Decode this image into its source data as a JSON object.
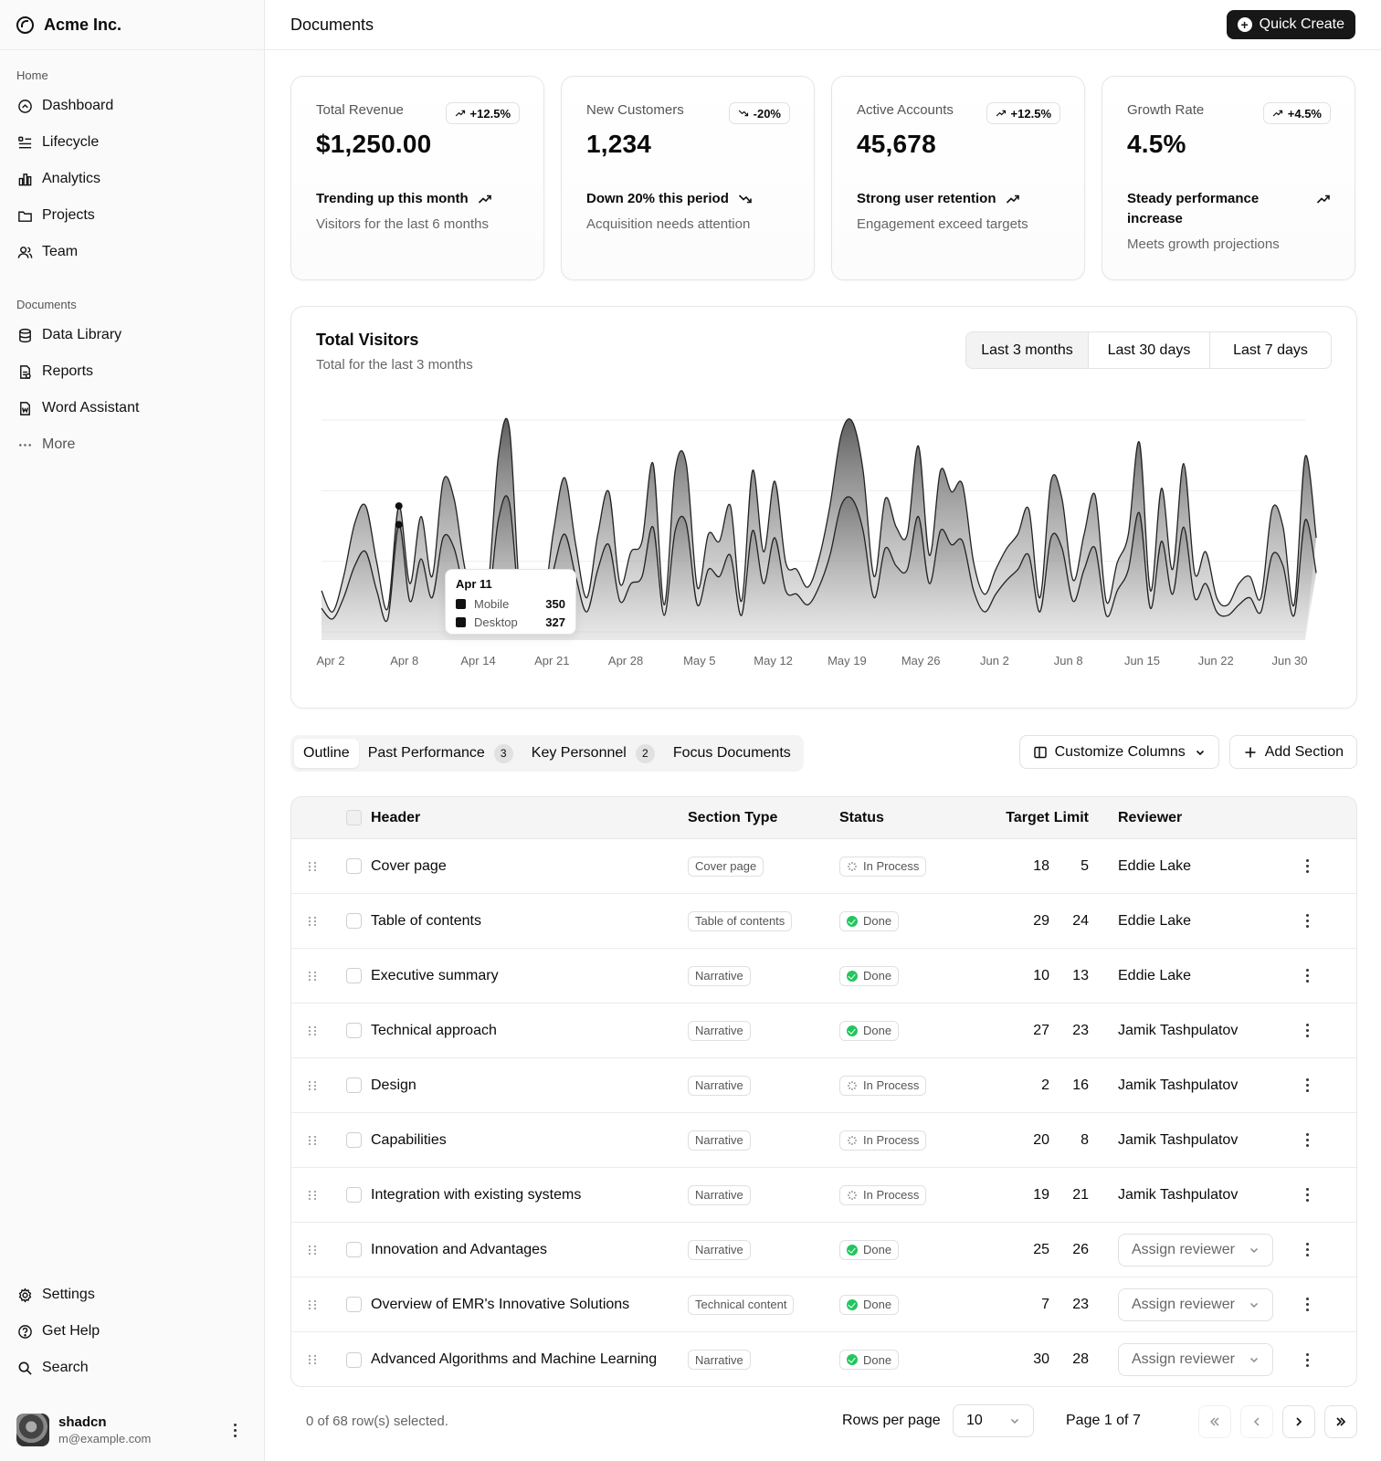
{
  "sidebar": {
    "brand": "Acme Inc.",
    "home_label": "Home",
    "home_items": [
      {
        "label": "Dashboard",
        "icon": "dashboard-icon"
      },
      {
        "label": "Lifecycle",
        "icon": "list-icon"
      },
      {
        "label": "Analytics",
        "icon": "bar-chart-icon"
      },
      {
        "label": "Projects",
        "icon": "folder-icon"
      },
      {
        "label": "Team",
        "icon": "users-icon"
      }
    ],
    "documents_label": "Documents",
    "doc_items": [
      {
        "label": "Data Library",
        "icon": "database-icon"
      },
      {
        "label": "Reports",
        "icon": "report-icon"
      },
      {
        "label": "Word Assistant",
        "icon": "file-word-icon"
      },
      {
        "label": "More",
        "icon": "dots-icon"
      }
    ],
    "bottom_items": [
      {
        "label": "Settings",
        "icon": "gear-icon"
      },
      {
        "label": "Get Help",
        "icon": "help-icon"
      },
      {
        "label": "Search",
        "icon": "search-icon"
      }
    ],
    "user": {
      "name": "shadcn",
      "email": "m@example.com"
    }
  },
  "header": {
    "title": "Documents",
    "quick_create": "Quick Create"
  },
  "cards": [
    {
      "label": "Total Revenue",
      "badge": "+12.5%",
      "badge_dir": "up",
      "value": "$1,250.00",
      "trend": "Trending up this month",
      "trend_dir": "up",
      "sub": "Visitors for the last 6 months"
    },
    {
      "label": "New Customers",
      "badge": "-20%",
      "badge_dir": "down",
      "value": "1,234",
      "trend": "Down 20% this period",
      "trend_dir": "down",
      "sub": "Acquisition needs attention"
    },
    {
      "label": "Active Accounts",
      "badge": "+12.5%",
      "badge_dir": "up",
      "value": "45,678",
      "trend": "Strong user retention",
      "trend_dir": "up",
      "sub": "Engagement exceed targets"
    },
    {
      "label": "Growth Rate",
      "badge": "+4.5%",
      "badge_dir": "up",
      "value": "4.5%",
      "trend": "Steady performance increase",
      "trend_dir": "up",
      "sub": "Meets growth projections"
    }
  ],
  "visitors": {
    "title": "Total Visitors",
    "subtitle": "Total for the last 3 months",
    "ranges": [
      "Last 3 months",
      "Last 30 days",
      "Last 7 days"
    ],
    "tooltip": {
      "date": "Apr 11",
      "rows": [
        {
          "name": "Mobile",
          "value": "350"
        },
        {
          "name": "Desktop",
          "value": "327"
        }
      ]
    }
  },
  "chart_data": {
    "type": "area",
    "x_ticks": [
      "Apr 2",
      "Apr 8",
      "Apr 14",
      "Apr 21",
      "Apr 28",
      "May 5",
      "May 12",
      "May 19",
      "May 26",
      "Jun 2",
      "Jun 8",
      "Jun 15",
      "Jun 22",
      "Jun 30"
    ],
    "days": 90,
    "ylim": [
      0,
      600
    ],
    "series": [
      {
        "name": "Mobile",
        "values": [
          140,
          80,
          180,
          330,
          380,
          220,
          90,
          380,
          160,
          350,
          180,
          450,
          400,
          200,
          150,
          130,
          520,
          600,
          110,
          170,
          95,
          310,
          460,
          270,
          120,
          300,
          420,
          160,
          250,
          280,
          500,
          100,
          480,
          500,
          150,
          300,
          280,
          380,
          110,
          480,
          250,
          450,
          220,
          200,
          150,
          230,
          380,
          580,
          620,
          480,
          180,
          400,
          320,
          300,
          550,
          240,
          480,
          420,
          440,
          220,
          130,
          200,
          260,
          300,
          370,
          120,
          450,
          400,
          170,
          300,
          410,
          110,
          220,
          300,
          560,
          140,
          430,
          200,
          500,
          190,
          250,
          120,
          100,
          160,
          180,
          120,
          370,
          320,
          100,
          520,
          290
        ]
      },
      {
        "name": "Desktop",
        "values": [
          90,
          60,
          120,
          210,
          250,
          140,
          60,
          327,
          110,
          230,
          120,
          290,
          260,
          130,
          100,
          80,
          340,
          390,
          70,
          110,
          60,
          200,
          300,
          180,
          80,
          200,
          270,
          110,
          160,
          180,
          320,
          70,
          310,
          330,
          100,
          200,
          180,
          240,
          70,
          310,
          160,
          290,
          140,
          130,
          100,
          150,
          240,
          380,
          400,
          310,
          120,
          260,
          210,
          200,
          350,
          160,
          310,
          270,
          280,
          140,
          80,
          130,
          170,
          200,
          240,
          80,
          290,
          260,
          110,
          200,
          260,
          70,
          140,
          200,
          360,
          90,
          280,
          130,
          320,
          120,
          160,
          80,
          70,
          100,
          120,
          80,
          240,
          210,
          70,
          340,
          190
        ]
      }
    ]
  },
  "tabs": {
    "items": [
      {
        "label": "Outline",
        "count": ""
      },
      {
        "label": "Past Performance",
        "count": "3"
      },
      {
        "label": "Key Personnel",
        "count": "2"
      },
      {
        "label": "Focus Documents",
        "count": ""
      }
    ],
    "customize": "Customize Columns",
    "add_section": "Add Section"
  },
  "table": {
    "columns": [
      "Header",
      "Section Type",
      "Status",
      "Target",
      "Limit",
      "Reviewer"
    ],
    "rows": [
      {
        "header": "Cover page",
        "type": "Cover page",
        "status": "In Process",
        "target": "18",
        "limit": "5",
        "reviewer": "Eddie Lake"
      },
      {
        "header": "Table of contents",
        "type": "Table of contents",
        "status": "Done",
        "target": "29",
        "limit": "24",
        "reviewer": "Eddie Lake"
      },
      {
        "header": "Executive summary",
        "type": "Narrative",
        "status": "Done",
        "target": "10",
        "limit": "13",
        "reviewer": "Eddie Lake"
      },
      {
        "header": "Technical approach",
        "type": "Narrative",
        "status": "Done",
        "target": "27",
        "limit": "23",
        "reviewer": "Jamik Tashpulatov"
      },
      {
        "header": "Design",
        "type": "Narrative",
        "status": "In Process",
        "target": "2",
        "limit": "16",
        "reviewer": "Jamik Tashpulatov"
      },
      {
        "header": "Capabilities",
        "type": "Narrative",
        "status": "In Process",
        "target": "20",
        "limit": "8",
        "reviewer": "Jamik Tashpulatov"
      },
      {
        "header": "Integration with existing systems",
        "type": "Narrative",
        "status": "In Process",
        "target": "19",
        "limit": "21",
        "reviewer": "Jamik Tashpulatov"
      },
      {
        "header": "Innovation and Advantages",
        "type": "Narrative",
        "status": "Done",
        "target": "25",
        "limit": "26",
        "reviewer": "",
        "assign": "Assign reviewer"
      },
      {
        "header": "Overview of EMR's Innovative Solutions",
        "type": "Technical content",
        "status": "Done",
        "target": "7",
        "limit": "23",
        "reviewer": "",
        "assign": "Assign reviewer"
      },
      {
        "header": "Advanced Algorithms and Machine Learning",
        "type": "Narrative",
        "status": "Done",
        "target": "30",
        "limit": "28",
        "reviewer": "",
        "assign": "Assign reviewer"
      }
    ]
  },
  "footer": {
    "selected": "0 of 68 row(s) selected.",
    "rows_per_page_label": "Rows per page",
    "rows_per_page": "10",
    "page_info": "Page 1 of 7"
  }
}
